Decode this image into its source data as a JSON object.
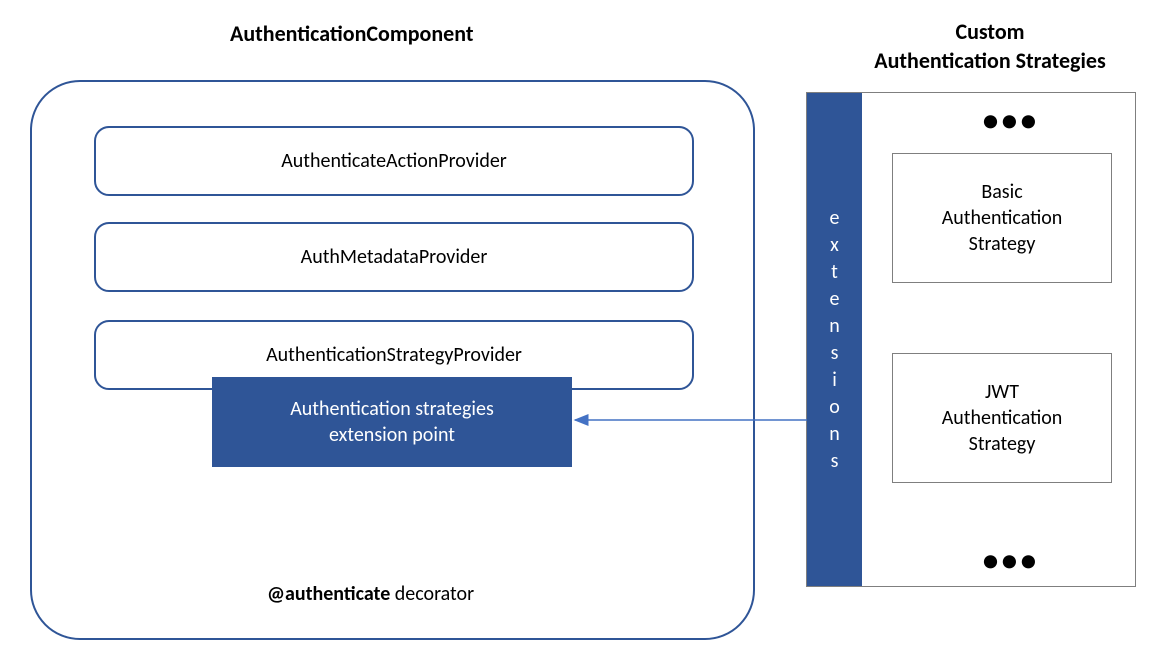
{
  "authComponent": {
    "title": "AuthenticationComponent",
    "providers": [
      "AuthenticateActionProvider",
      "AuthMetadataProvider",
      "AuthenticationStrategyProvider"
    ],
    "extensionPoint": "Authentication strategies\nextension point",
    "decoratorBold": "@authenticate",
    "decoratorRest": "  decorator"
  },
  "customStrategies": {
    "title": "Custom\nAuthentication Strategies",
    "extensionsLabel": "extensions",
    "ellipsis": "●●●",
    "items": [
      "Basic\nAuthentication\nStrategy",
      "JWT\nAuthentication\nStrategy"
    ]
  }
}
